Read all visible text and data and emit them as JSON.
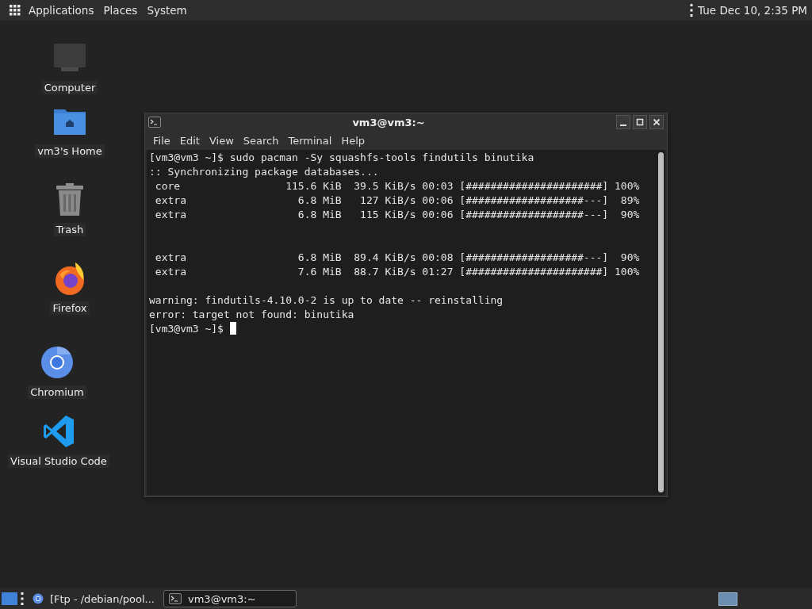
{
  "top_panel": {
    "menus": [
      "Applications",
      "Places",
      "System"
    ],
    "clock": "Tue Dec 10,  2:35 PM"
  },
  "desktop_icons": [
    {
      "kind": "computer",
      "label": "Computer"
    },
    {
      "kind": "home",
      "label": "vm3's Home"
    },
    {
      "kind": "trash",
      "label": "Trash"
    },
    {
      "kind": "firefox",
      "label": "Firefox"
    },
    {
      "kind": "chromium",
      "label": "Chromium"
    },
    {
      "kind": "vscode",
      "label": "Visual Studio Code"
    }
  ],
  "window": {
    "title": "vm3@vm3:~",
    "menu": [
      "File",
      "Edit",
      "View",
      "Search",
      "Terminal",
      "Help"
    ],
    "lines": [
      {
        "kind": "text",
        "text": "[vm3@vm3 ~]$ sudo pacman -Sy squashfs-tools findutils binutika"
      },
      {
        "kind": "text",
        "text": ":: Synchronizing package databases..."
      },
      {
        "kind": "text",
        "text": " core                 115.6 KiB  39.5 KiB/s 00:03 [######################] 100%"
      },
      {
        "kind": "text",
        "text": " extra                  6.8 MiB   127 KiB/s 00:06 [###################---]  89%"
      },
      {
        "kind": "text",
        "text": " extra                  6.8 MiB   115 KiB/s 00:06 [###################---]  90%"
      },
      {
        "kind": "blank"
      },
      {
        "kind": "blank"
      },
      {
        "kind": "text",
        "text": " extra                  6.8 MiB  89.4 KiB/s 00:08 [###################---]  90%"
      },
      {
        "kind": "text",
        "text": " extra                  7.6 MiB  88.7 KiB/s 01:27 [######################] 100%"
      },
      {
        "kind": "blank"
      },
      {
        "kind": "text",
        "text": "warning: findutils-4.10.0-2 is up to date -- reinstalling"
      },
      {
        "kind": "text",
        "text": "error: target not found: binutika"
      },
      {
        "kind": "prompt",
        "text": "[vm3@vm3 ~]$"
      }
    ]
  },
  "taskbar": {
    "tasks": [
      {
        "kind": "browser",
        "label": "[Ftp - /debian/pool...",
        "selected": false
      },
      {
        "kind": "terminal",
        "label": "vm3@vm3:~",
        "selected": true
      }
    ]
  }
}
